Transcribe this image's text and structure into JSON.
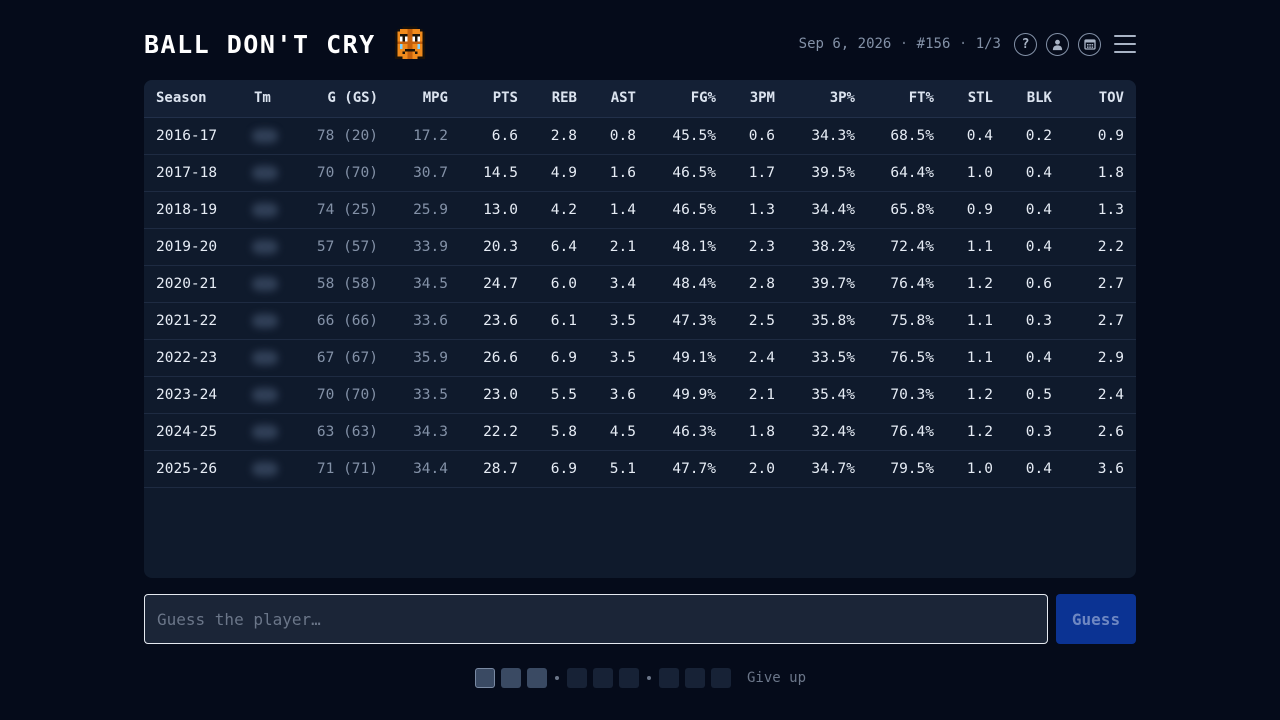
{
  "header": {
    "title": "BALL DON'T CRY",
    "date": "Sep 6, 2026",
    "puzzle_number": "#156",
    "attempt": "1/3",
    "help_label": "?"
  },
  "table": {
    "columns": [
      "Season",
      "Tm",
      "G (GS)",
      "MPG",
      "PTS",
      "REB",
      "AST",
      "FG%",
      "3PM",
      "3P%",
      "FT%",
      "STL",
      "BLK",
      "TOV"
    ],
    "rows": [
      [
        "2016-17",
        "",
        "78 (20)",
        "17.2",
        "6.6",
        "2.8",
        "0.8",
        "45.5%",
        "0.6",
        "34.3%",
        "68.5%",
        "0.4",
        "0.2",
        "0.9"
      ],
      [
        "2017-18",
        "",
        "70 (70)",
        "30.7",
        "14.5",
        "4.9",
        "1.6",
        "46.5%",
        "1.7",
        "39.5%",
        "64.4%",
        "1.0",
        "0.4",
        "1.8"
      ],
      [
        "2018-19",
        "",
        "74 (25)",
        "25.9",
        "13.0",
        "4.2",
        "1.4",
        "46.5%",
        "1.3",
        "34.4%",
        "65.8%",
        "0.9",
        "0.4",
        "1.3"
      ],
      [
        "2019-20",
        "",
        "57 (57)",
        "33.9",
        "20.3",
        "6.4",
        "2.1",
        "48.1%",
        "2.3",
        "38.2%",
        "72.4%",
        "1.1",
        "0.4",
        "2.2"
      ],
      [
        "2020-21",
        "",
        "58 (58)",
        "34.5",
        "24.7",
        "6.0",
        "3.4",
        "48.4%",
        "2.8",
        "39.7%",
        "76.4%",
        "1.2",
        "0.6",
        "2.7"
      ],
      [
        "2021-22",
        "",
        "66 (66)",
        "33.6",
        "23.6",
        "6.1",
        "3.5",
        "47.3%",
        "2.5",
        "35.8%",
        "75.8%",
        "1.1",
        "0.3",
        "2.7"
      ],
      [
        "2022-23",
        "",
        "67 (67)",
        "35.9",
        "26.6",
        "6.9",
        "3.5",
        "49.1%",
        "2.4",
        "33.5%",
        "76.5%",
        "1.1",
        "0.4",
        "2.9"
      ],
      [
        "2023-24",
        "",
        "70 (70)",
        "33.5",
        "23.0",
        "5.5",
        "3.6",
        "49.9%",
        "2.1",
        "35.4%",
        "70.3%",
        "1.2",
        "0.5",
        "2.4"
      ],
      [
        "2024-25",
        "",
        "63 (63)",
        "34.3",
        "22.2",
        "5.8",
        "4.5",
        "46.3%",
        "1.8",
        "32.4%",
        "76.4%",
        "1.2",
        "0.3",
        "2.6"
      ],
      [
        "2025-26",
        "",
        "71 (71)",
        "34.4",
        "28.7",
        "6.9",
        "5.1",
        "47.7%",
        "2.0",
        "34.7%",
        "79.5%",
        "1.0",
        "0.4",
        "3.6"
      ]
    ]
  },
  "guess": {
    "placeholder": "Guess the player…",
    "value": "",
    "button_label": "Guess"
  },
  "progress": {
    "give_up_label": "Give up"
  },
  "colors": {
    "background": "#050b1a",
    "panel": "#0f1a2c",
    "accent_button": "#0b3393",
    "logo_orange": "#f08a1c"
  }
}
